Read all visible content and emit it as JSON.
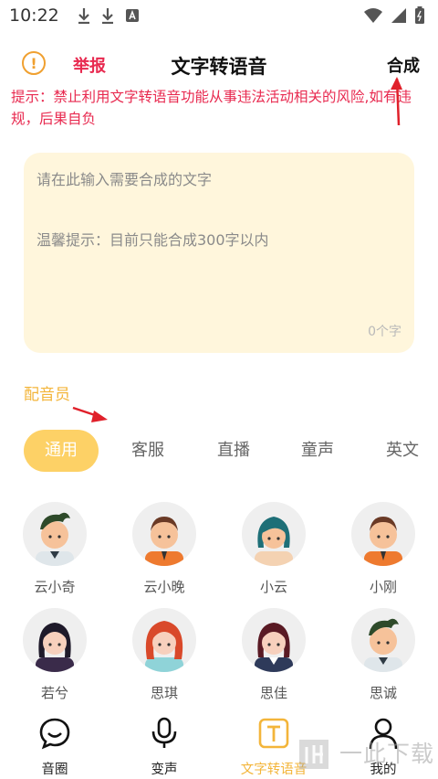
{
  "status_bar": {
    "time": "10:22"
  },
  "header": {
    "report_label": "举报",
    "title": "文字转语音",
    "synthesize_label": "合成"
  },
  "notice": "提示：禁止利用文字转语音功能从事违法活动相关的风险,如有违规，后果自负",
  "text_input": {
    "placeholder_line1": "请在此输入需要合成的文字",
    "placeholder_line2": "温馨提示：目前只能合成300字以内",
    "char_count": "0个字"
  },
  "voice_section_label": "配音员",
  "tabs": [
    {
      "label": "通用",
      "active": true
    },
    {
      "label": "客服",
      "active": false
    },
    {
      "label": "直播",
      "active": false
    },
    {
      "label": "童声",
      "active": false
    },
    {
      "label": "英文",
      "active": false
    }
  ],
  "voices": [
    {
      "name": "云小奇",
      "icon": "male-avatar-icon"
    },
    {
      "name": "云小晚",
      "icon": "male-avatar-icon"
    },
    {
      "name": "小云",
      "icon": "female-avatar-icon"
    },
    {
      "name": "小刚",
      "icon": "male-avatar-icon"
    },
    {
      "name": "若兮",
      "icon": "female-avatar-icon"
    },
    {
      "name": "思琪",
      "icon": "female-avatar-icon"
    },
    {
      "name": "思佳",
      "icon": "female-avatar-icon"
    },
    {
      "name": "思诚",
      "icon": "male-avatar-icon"
    }
  ],
  "bottom_nav": [
    {
      "label": "音圈",
      "icon": "chat-bubble-icon",
      "active": false
    },
    {
      "label": "变声",
      "icon": "microphone-icon",
      "active": false
    },
    {
      "label": "文字转语音",
      "icon": "text-t-icon",
      "active": true
    },
    {
      "label": "我的",
      "icon": "person-icon",
      "active": false
    }
  ],
  "watermark_text": "一此下载",
  "colors": {
    "accent_yellow": "#fdd166",
    "accent_red": "#e8294f",
    "input_bg": "#fff6dc"
  }
}
